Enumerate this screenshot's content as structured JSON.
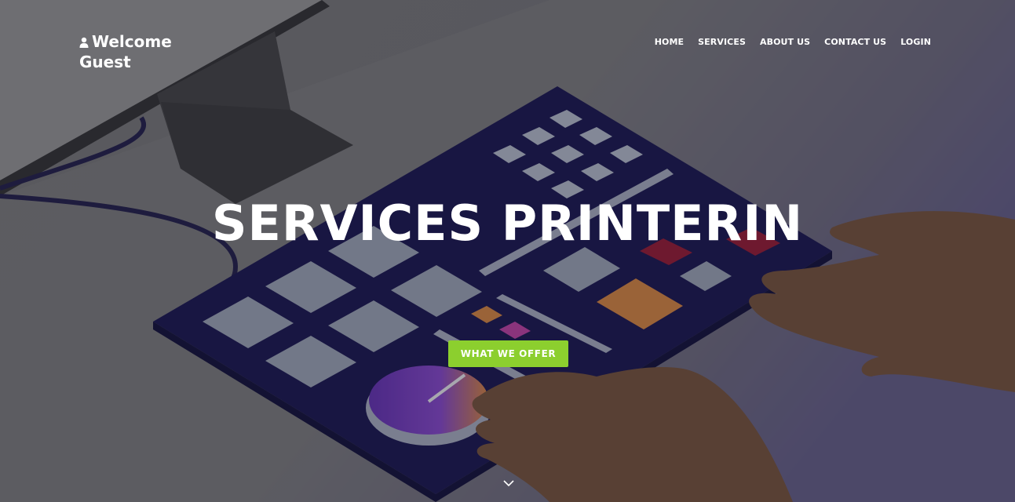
{
  "brand": {
    "greeting": "Welcome Guest",
    "icon": "user-icon"
  },
  "nav": {
    "items": [
      {
        "label": "HOME"
      },
      {
        "label": "SERVICES"
      },
      {
        "label": "ABOUT US"
      },
      {
        "label": "CONTACT US"
      },
      {
        "label": "LOGIN"
      }
    ]
  },
  "hero": {
    "title": "SERVICES PRINTERIN",
    "cta_label": "WHAT WE OFFER",
    "scroll_icon": "chevron-down-icon"
  },
  "colors": {
    "accent": "#8ccf2e",
    "text": "#ffffff",
    "device_body": "#1a1550"
  }
}
